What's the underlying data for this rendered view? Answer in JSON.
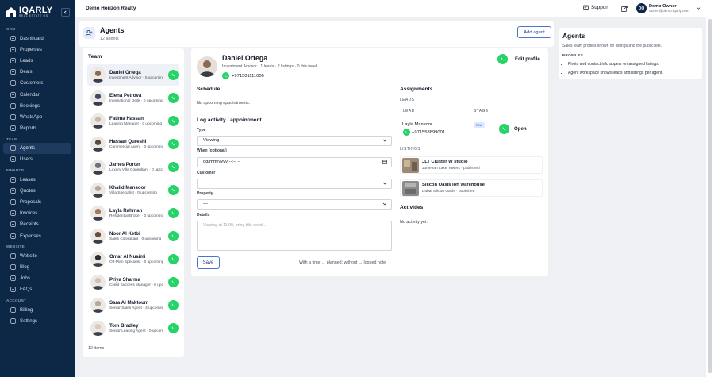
{
  "brand": {
    "name": "IQARLY",
    "tagline": "REAL ESTATE OS"
  },
  "sidebar": {
    "sections": [
      {
        "title": "CRM",
        "items": [
          {
            "label": "Dashboard",
            "icon": "grid-icon"
          },
          {
            "label": "Properties",
            "icon": "building-icon"
          },
          {
            "label": "Leads",
            "icon": "target-icon"
          },
          {
            "label": "Deals",
            "icon": "briefcase-icon"
          },
          {
            "label": "Customers",
            "icon": "users-icon"
          },
          {
            "label": "Calendar",
            "icon": "calendar-icon"
          },
          {
            "label": "Bookings",
            "icon": "calendar-check-icon"
          },
          {
            "label": "WhatsApp",
            "icon": "chat-icon"
          },
          {
            "label": "Reports",
            "icon": "chart-icon"
          }
        ]
      },
      {
        "title": "TEAM",
        "items": [
          {
            "label": "Agents",
            "icon": "user-badge-icon",
            "active": true
          },
          {
            "label": "Users",
            "icon": "user-icon"
          }
        ]
      },
      {
        "title": "FINANCE",
        "items": [
          {
            "label": "Leases",
            "icon": "document-icon"
          },
          {
            "label": "Quotes",
            "icon": "quote-icon"
          },
          {
            "label": "Proposals",
            "icon": "proposal-icon"
          },
          {
            "label": "Invoices",
            "icon": "invoice-icon"
          },
          {
            "label": "Receipts",
            "icon": "receipt-icon"
          },
          {
            "label": "Expenses",
            "icon": "wallet-icon"
          }
        ]
      },
      {
        "title": "WEBSITE",
        "items": [
          {
            "label": "Website",
            "icon": "globe-icon"
          },
          {
            "label": "Blog",
            "icon": "pen-icon"
          },
          {
            "label": "Jobs",
            "icon": "bag-icon"
          },
          {
            "label": "FAQs",
            "icon": "help-icon"
          }
        ]
      },
      {
        "title": "ACCOUNT",
        "items": [
          {
            "label": "Billing",
            "icon": "card-icon"
          },
          {
            "label": "Settings",
            "icon": "gear-icon"
          }
        ]
      }
    ]
  },
  "topbar": {
    "org": "Demo Horizon Realty",
    "support": "Support",
    "user": {
      "initials": "DO",
      "name": "Demo Owner",
      "email": "owner@demo.iqarly.com"
    }
  },
  "page": {
    "title": "Agents",
    "count": "12 agents",
    "add_button": "Add agent"
  },
  "help": {
    "title": "Agents",
    "description": "Sales team profiles shown on listings and the public site.",
    "subtitle": "PROFILES",
    "bullets": [
      "Photo and contact info appear on assigned listings.",
      "Agent workspace shows leads and listings per agent."
    ]
  },
  "team": {
    "title": "Team",
    "footer": "12 items",
    "agents": [
      {
        "name": "Daniel Ortega",
        "role": "Investment Advisor · 0 upcoming",
        "active": true,
        "tone": "#8a6a52"
      },
      {
        "name": "Elena Petrova",
        "role": "International Desk · 0 upcoming",
        "tone": "#3b4a66"
      },
      {
        "name": "Fatima Hassan",
        "role": "Leasing Manager · 0 upcoming",
        "tone": "#c9b8a8"
      },
      {
        "name": "Hassan Qureshi",
        "role": "Commercial Agent · 0 upcoming",
        "tone": "#5a4a3e"
      },
      {
        "name": "James Porter",
        "role": "Luxury Villa Consultant · 0 upcoming",
        "tone": "#6b7280"
      },
      {
        "name": "Khalid Mansoor",
        "role": "Villa Specialist · 0 upcoming",
        "tone": "#b9a595"
      },
      {
        "name": "Layla Rahman",
        "role": "Residential Broker · 0 upcoming",
        "tone": "#a3785e"
      },
      {
        "name": "Noor Al Ketbi",
        "role": "Sales Consultant · 0 upcoming",
        "tone": "#6b4b3a"
      },
      {
        "name": "Omar Al Nuaimi",
        "role": "Off-Plan Specialist · 0 upcoming",
        "tone": "#2d2d34"
      },
      {
        "name": "Priya Sharma",
        "role": "Client Success Manager · 0 upcoming",
        "tone": "#cfc3b8"
      },
      {
        "name": "Sara Al Maktoum",
        "role": "Senior Sales Agent · 4 upcoming",
        "tone": "#b8a89c"
      },
      {
        "name": "Tom Bradley",
        "role": "Senior Leasing Agent · 0 upcoming",
        "tone": "#d6ccc4"
      }
    ]
  },
  "detail": {
    "name": "Daniel Ortega",
    "meta": "Investment Advisor · 1 leads · 2 listings · 0 this week",
    "phone": "+971501111006",
    "edit_profile": "Edit profile",
    "schedule_title": "Schedule",
    "no_appointments": "No upcoming appointments.",
    "log_title": "Log activity / appointment",
    "form": {
      "type_label": "Type",
      "type_value": "Viewing",
      "when_label": "When (optional)",
      "when_value": "dd/mm/yyyy --:-- --",
      "customer_label": "Customer",
      "customer_value": "—",
      "property_label": "Property",
      "property_value": "—",
      "details_label": "Details",
      "details_placeholder": "Viewing at 11:00, bring title deed...",
      "save": "Save",
      "hint": "With a time → planned; without → logged note"
    },
    "assignments_title": "Assignments",
    "leads_caption": "LEADS",
    "leads_headers": {
      "lead": "LEAD",
      "stage": "STAGE"
    },
    "lead": {
      "name": "Layla Mansoor",
      "phone": "+971558899001",
      "stage": "new",
      "action": "Open"
    },
    "listings_caption": "LISTINGS",
    "listings": [
      {
        "title": "JLT Cluster W studio",
        "subtitle": "Jumeirah Lake Towers · published",
        "tone": "#9c8a74"
      },
      {
        "title": "Silicon Oasis loft warehouse",
        "subtitle": "Dubai Silicon Oasis · published",
        "tone": "#8c8c8c"
      }
    ],
    "activities_title": "Activities",
    "no_activity": "No activity yet."
  }
}
